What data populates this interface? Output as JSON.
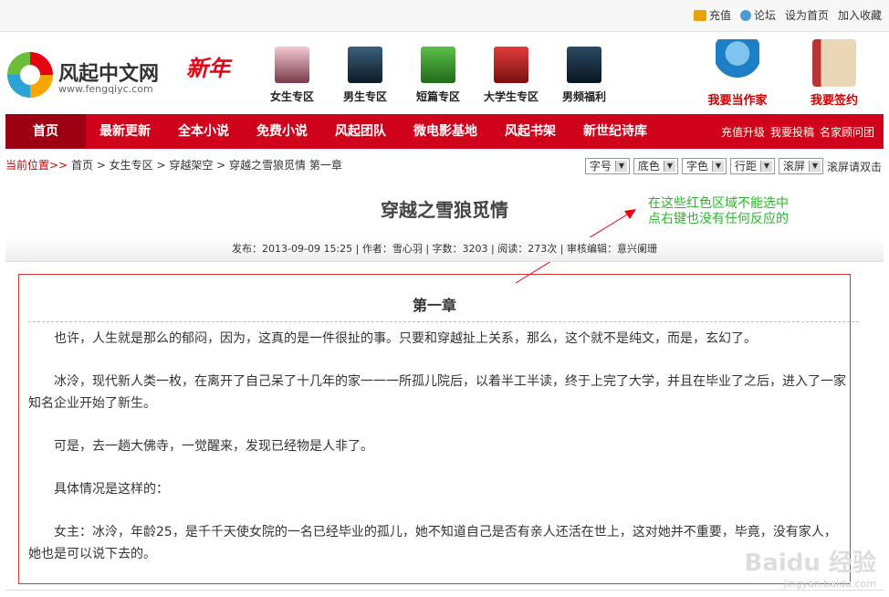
{
  "topbar": {
    "links": [
      "充值",
      "论坛",
      "设为首页",
      "加入收藏"
    ]
  },
  "logo": {
    "name": "风起中文网",
    "url": "www.fengqiyc.com",
    "badge": "新年"
  },
  "categories": [
    "女生专区",
    "男生专区",
    "短篇专区",
    "大学生专区",
    "男频福利"
  ],
  "right_buttons": [
    "我要当作家",
    "我要签约"
  ],
  "nav": {
    "items": [
      "首页",
      "最新更新",
      "全本小说",
      "免费小说",
      "风起团队",
      "微电影基地",
      "风起书架",
      "新世纪诗库"
    ],
    "sub": [
      "充值升级",
      "我要投稿",
      "名家顾问团"
    ]
  },
  "breadcrumb": {
    "prefix": "当前位置>>",
    "path": "首页 > 女生专区 > 穿越架空 > 穿越之雪狼觅情 第一章"
  },
  "tools": {
    "selects": [
      "字号",
      "底色",
      "字色",
      "行距",
      "滚屏"
    ],
    "hint": "滚屏请双击"
  },
  "book": {
    "title": "穿越之雪狼觅情",
    "meta": "发布：2013-09-09 15:25  |  作者：雪心羽  |  字数：3203  |  阅读：273次  |  审核编辑：意兴阑珊"
  },
  "annotation": {
    "line1": "在这些红色区域不能选中",
    "line2": "点右键也没有任何反应的"
  },
  "chapter": {
    "title": "第一章",
    "paragraphs": [
      "也许，人生就是那么的郁闷，因为，这真的是一件很扯的事。只要和穿越扯上关系，那么，这个就不是纯文，而是，玄幻了。",
      "冰泠，现代新人类一枚，在离开了自己呆了十几年的家一一一所孤儿院后，以着半工半读，终于上完了大学，并且在毕业了之后，进入了一家知名企业开始了新生。",
      "可是，去一趟大佛寺，一觉醒来，发现已经物是人非了。",
      "具体情况是这样的：",
      "女主：冰泠，年龄25，是千千天使女院的一名已经毕业的孤儿，她不知道自己是否有亲人还活在世上，这对她并不重要，毕竟，没有家人，她也是可以说下去的。"
    ]
  },
  "watermark": {
    "brand": "Baidu 经验",
    "url": "jingyan.baidu.com"
  }
}
